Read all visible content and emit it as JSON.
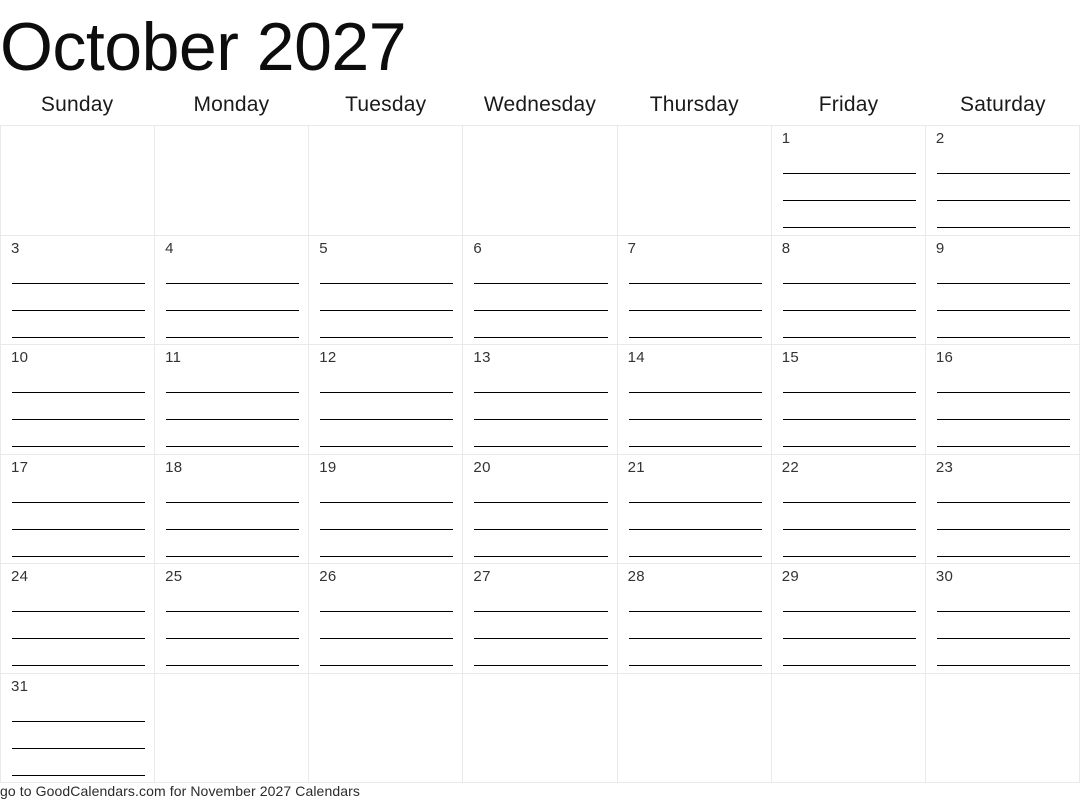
{
  "calendar": {
    "title": "October 2027",
    "month": "October",
    "year": "2027",
    "weekday_headers": [
      "Sunday",
      "Monday",
      "Tuesday",
      "Wednesday",
      "Thursday",
      "Friday",
      "Saturday"
    ],
    "lines_per_day": 4,
    "first_day_column_index": 5,
    "days_in_month": 31,
    "weeks": [
      [
        {
          "date": "",
          "empty": true
        },
        {
          "date": "",
          "empty": true
        },
        {
          "date": "",
          "empty": true
        },
        {
          "date": "",
          "empty": true
        },
        {
          "date": "",
          "empty": true
        },
        {
          "date": "1",
          "empty": false
        },
        {
          "date": "2",
          "empty": false
        }
      ],
      [
        {
          "date": "3",
          "empty": false
        },
        {
          "date": "4",
          "empty": false
        },
        {
          "date": "5",
          "empty": false
        },
        {
          "date": "6",
          "empty": false
        },
        {
          "date": "7",
          "empty": false
        },
        {
          "date": "8",
          "empty": false
        },
        {
          "date": "9",
          "empty": false
        }
      ],
      [
        {
          "date": "10",
          "empty": false
        },
        {
          "date": "11",
          "empty": false
        },
        {
          "date": "12",
          "empty": false
        },
        {
          "date": "13",
          "empty": false
        },
        {
          "date": "14",
          "empty": false
        },
        {
          "date": "15",
          "empty": false
        },
        {
          "date": "16",
          "empty": false
        }
      ],
      [
        {
          "date": "17",
          "empty": false
        },
        {
          "date": "18",
          "empty": false
        },
        {
          "date": "19",
          "empty": false
        },
        {
          "date": "20",
          "empty": false
        },
        {
          "date": "21",
          "empty": false
        },
        {
          "date": "22",
          "empty": false
        },
        {
          "date": "23",
          "empty": false
        }
      ],
      [
        {
          "date": "24",
          "empty": false
        },
        {
          "date": "25",
          "empty": false
        },
        {
          "date": "26",
          "empty": false
        },
        {
          "date": "27",
          "empty": false
        },
        {
          "date": "28",
          "empty": false
        },
        {
          "date": "29",
          "empty": false
        },
        {
          "date": "30",
          "empty": false
        }
      ],
      [
        {
          "date": "31",
          "empty": false
        },
        {
          "date": "",
          "empty": true
        },
        {
          "date": "",
          "empty": true
        },
        {
          "date": "",
          "empty": true
        },
        {
          "date": "",
          "empty": true
        },
        {
          "date": "",
          "empty": true
        },
        {
          "date": "",
          "empty": true
        }
      ]
    ]
  },
  "footer": {
    "note": "go to GoodCalendars.com for November 2027 Calendars"
  },
  "colors": {
    "background": "#ffffff",
    "grid_line": "#e9e9e9",
    "write_line": "#000000",
    "title_text": "#0d0d0d",
    "day_number_text": "#333333",
    "footer_text": "#2b2b2b"
  }
}
